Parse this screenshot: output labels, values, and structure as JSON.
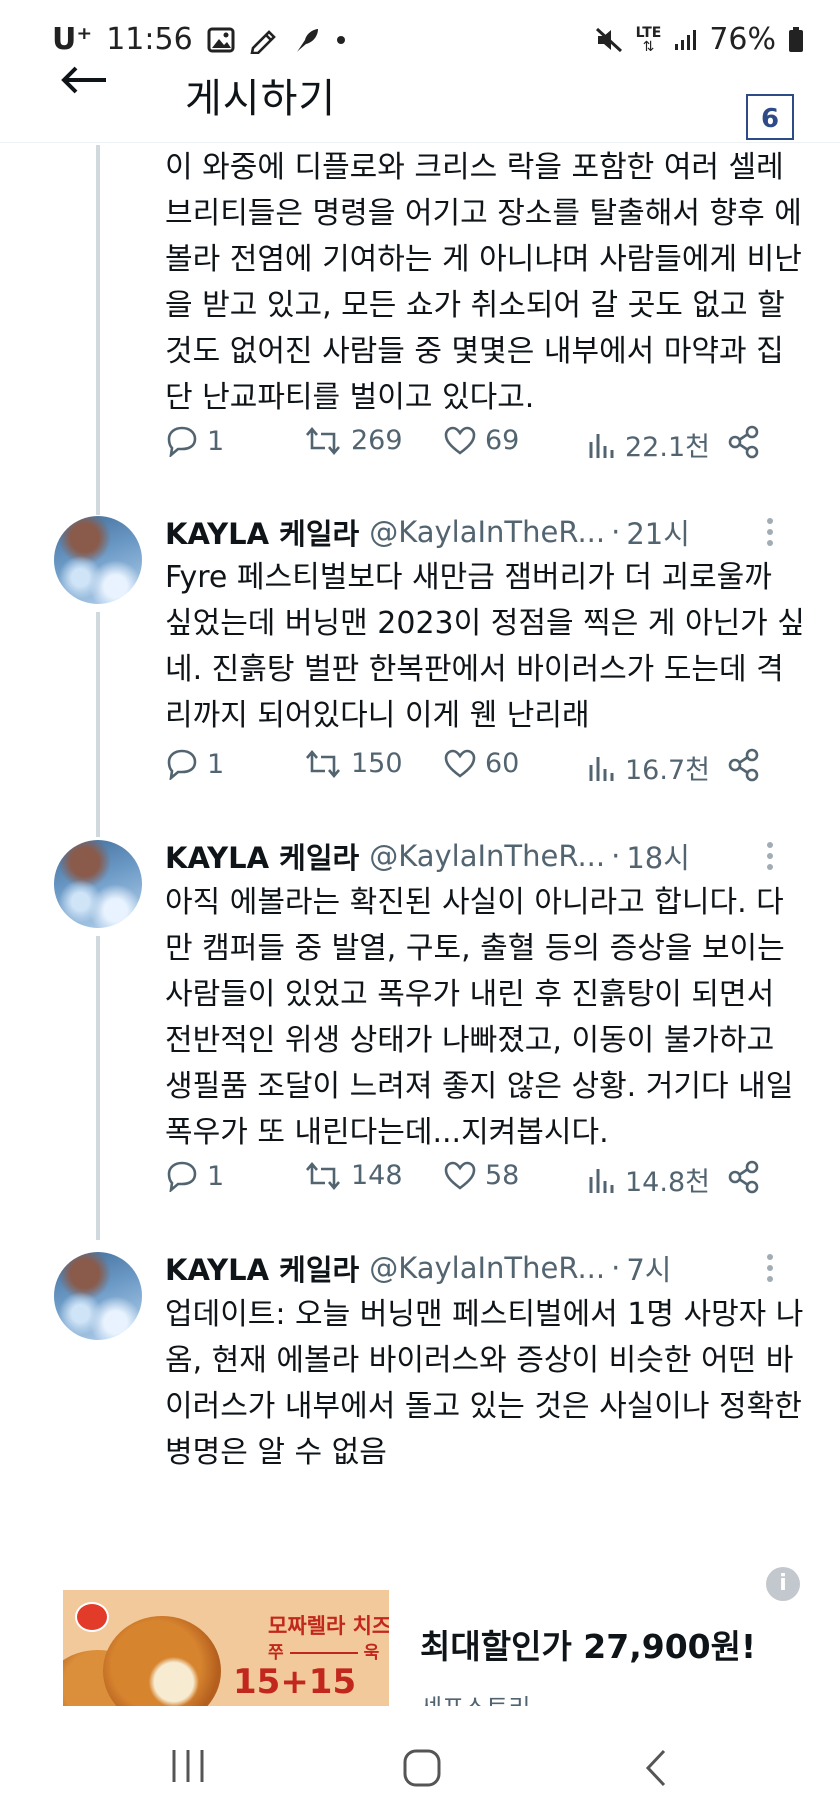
{
  "status_bar": {
    "carrier": "U⁺",
    "time": "11:56",
    "network": "LTE",
    "battery": "76%"
  },
  "header": {
    "title": "게시하기"
  },
  "page_badge": "6",
  "tweets": [
    {
      "text": "이 와중에 디플로와 크리스 락을 포함한 여러 셀레브리티들은 명령을 어기고 장소를 탈출해서 향후 에볼라 전염에 기여하는 게 아니냐며 사람들에게 비난을 받고 있고, 모든 쇼가 취소되어 갈 곳도 없고 할 것도 없어진 사람들 중 몇몇은 내부에서 마약과 집단 난교파티를 벌이고 있다고.",
      "replies": "1",
      "retweets": "269",
      "likes": "69",
      "views": "22.1천"
    },
    {
      "name": "KAYLA 케일라",
      "handle": "@KaylaInTheR...",
      "time": "21시",
      "text": "Fyre 페스티벌보다 새만금 잼버리가 더 괴로울까 싶었는데 버닝맨 2023이 정점을 찍은 게 아닌가 싶네. 진흙탕 벌판 한복판에서 바이러스가 도는데 격리까지 되어있다니 이게 웬 난리래",
      "replies": "1",
      "retweets": "150",
      "likes": "60",
      "views": "16.7천"
    },
    {
      "name": "KAYLA 케일라",
      "handle": "@KaylaInTheR...",
      "time": "18시",
      "text": "아직 에볼라는 확진된 사실이 아니라고 합니다. 다만 캠퍼들 중 발열, 구토, 출혈 등의 증상을 보이는 사람들이 있었고 폭우가 내린 후 진흙탕이 되면서 전반적인 위생 상태가 나빠졌고, 이동이 불가하고 생필품 조달이 느려져 좋지 않은 상황. 거기다 내일 폭우가 또 내린다는데...지켜봅시다.",
      "replies": "1",
      "retweets": "148",
      "likes": "58",
      "views": "14.8천"
    },
    {
      "name": "KAYLA 케일라",
      "handle": "@KaylaInTheR...",
      "time": "7시",
      "text": "업데이트: 오늘 버닝맨 페스티벌에서 1명 사망자 나옴, 현재 에볼라 바이러스와 증상이 비슷한 어떤 바이러스가 내부에서 돌고 있는 것은 사실이나 정확한 병명은 알 수 없음"
    }
  ],
  "ad": {
    "image_line1": "모짜렐라 치즈가",
    "image_line2_a": "쭈",
    "image_line2_b": "욱",
    "image_line3": "15+15",
    "headline": "최대할인가 27,900원!",
    "brand": "셰프스토리",
    "info_icon": "i"
  },
  "icons": {
    "reply": "reply-icon",
    "retweet": "retweet-icon",
    "like": "heart-icon",
    "views": "analytics-icon",
    "share": "share-icon"
  },
  "colors": {
    "text": "#0f1419",
    "muted": "#536471",
    "thread_line": "#cfd9de",
    "badge": "#2e4a87"
  }
}
